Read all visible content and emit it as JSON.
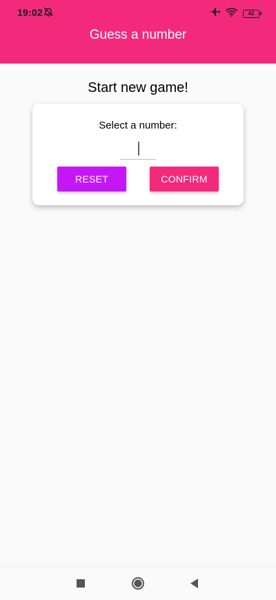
{
  "status_bar": {
    "time": "19:02",
    "battery": "42",
    "icons": [
      "notifications-off-icon",
      "airplane-icon",
      "wifi-icon",
      "battery-icon"
    ]
  },
  "header": {
    "title": "Guess a number"
  },
  "screen": {
    "title": "Start new game!",
    "card": {
      "label": "Select a number:",
      "input_value": "",
      "reset_label": "RESET",
      "confirm_label": "CONFIRM"
    }
  },
  "navigation": {
    "buttons": [
      "recents-icon",
      "home-icon",
      "back-icon"
    ]
  },
  "colors": {
    "primary": "#f32a7c",
    "accent": "#c517f5",
    "background": "#fafafa"
  }
}
